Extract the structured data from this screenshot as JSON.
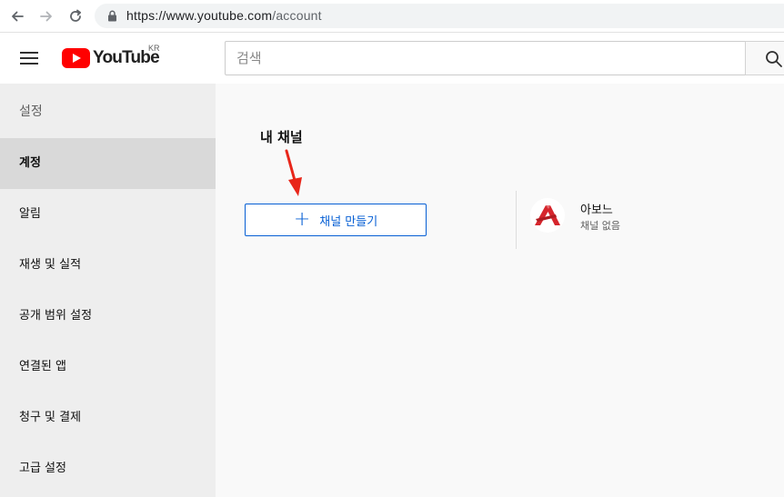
{
  "browser": {
    "url_host": "https://www.youtube.com",
    "url_path": "/account"
  },
  "header": {
    "logo_text": "YouTube",
    "region": "KR",
    "search_placeholder": "검색"
  },
  "sidebar": {
    "title": "설정",
    "items": [
      {
        "label": "계정",
        "active": true
      },
      {
        "label": "알림"
      },
      {
        "label": "재생 및 실적"
      },
      {
        "label": "공개 범위 설정"
      },
      {
        "label": "연결된 앱"
      },
      {
        "label": "청구 및 결제"
      },
      {
        "label": "고급 설정"
      }
    ]
  },
  "main": {
    "annotation_label": "내 채널",
    "create_channel_label": "채널 만들기",
    "account": {
      "name": "아보느",
      "status": "채널 없음"
    }
  },
  "colors": {
    "youtube_red": "#ff0000",
    "link_blue": "#065fd4",
    "annotation_arrow": "#e8261a",
    "avatar_logo": "#d6262d"
  }
}
